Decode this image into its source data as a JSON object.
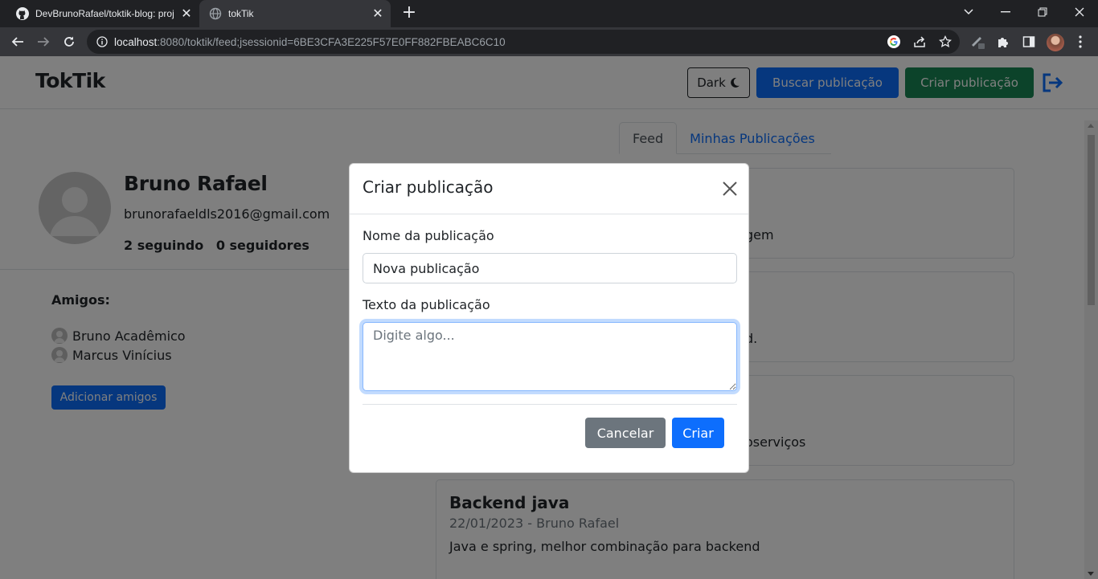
{
  "browser": {
    "tabs": [
      {
        "title": "DevBrunoRafael/toktik-blog: proj",
        "active": false,
        "icon": "github-icon"
      },
      {
        "title": "tokTik",
        "active": true,
        "icon": "globe-icon"
      }
    ],
    "url": {
      "host": "localhost",
      "path": ":8080/toktik/feed;jsessionid=6BE3CFA3E225F57E0FF882FBEABC6C10"
    }
  },
  "header": {
    "brand": "TokTik",
    "dark_label": "Dark",
    "search_label": "Buscar publicação",
    "create_label": "Criar publicação"
  },
  "profile": {
    "name": "Bruno Rafael",
    "email": "brunorafaeldls2016@gmail.com",
    "following": "2 seguindo",
    "followers": "0 seguidores"
  },
  "friends": {
    "title": "Amigos:",
    "items": [
      {
        "name": "Bruno Acadêmico"
      },
      {
        "name": "Marcus Vinícius"
      }
    ],
    "add_label": "Adicionar amigos"
  },
  "feed_tabs": [
    {
      "label": "Feed",
      "active": true
    },
    {
      "label": "Minhas Publicações",
      "active": false
    }
  ],
  "posts": [
    {
      "body_visible": "gem"
    },
    {
      "body_visible": "d."
    },
    {
      "body_visible": "oserviços"
    },
    {
      "title": "Backend java",
      "meta": "22/01/2023 - Bruno Rafael",
      "body": "Java e spring, melhor combinação para backend"
    }
  ],
  "modal": {
    "title": "Criar publicação",
    "name_label": "Nome da publicação",
    "name_value": "Nova publicação",
    "text_label": "Texto da publicação",
    "text_placeholder": "Digite algo...",
    "cancel_label": "Cancelar",
    "submit_label": "Criar"
  },
  "colors": {
    "primary": "#0d6efd",
    "success": "#198754",
    "secondary": "#6c757d"
  }
}
